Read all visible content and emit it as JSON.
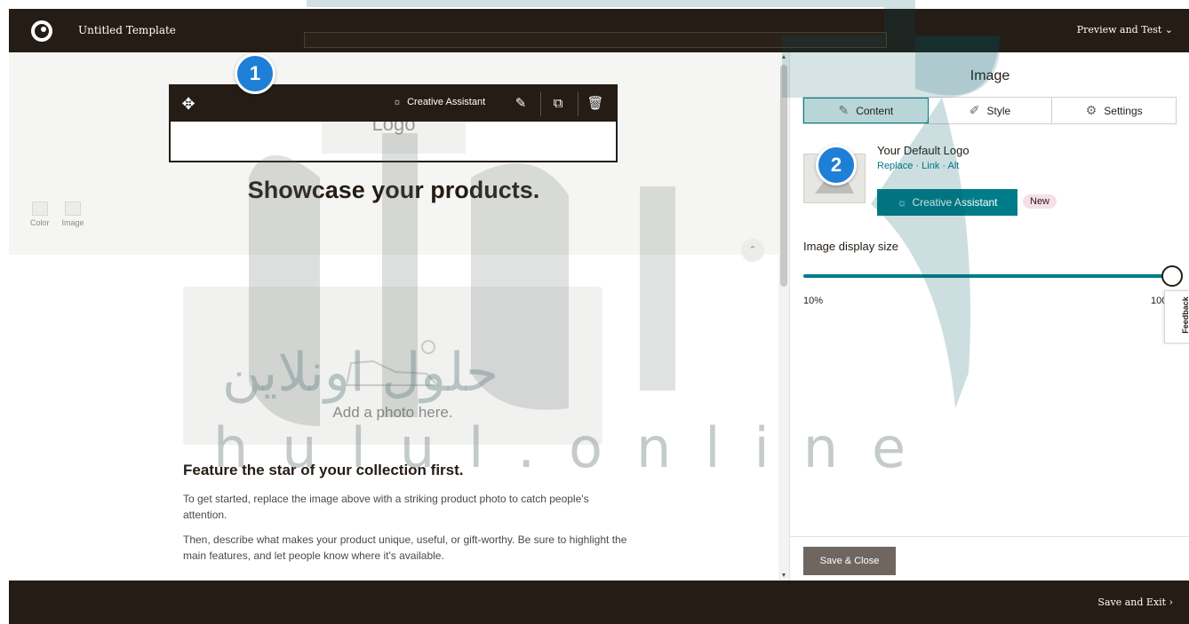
{
  "topbar": {
    "title": "Untitled Template",
    "preview_label": "Preview and Test"
  },
  "canvas": {
    "background_tools": {
      "color_label": "Color",
      "image_label": "Image"
    },
    "logo_placeholder": "Logo",
    "toolbar": {
      "creative_assistant_label": "Creative Assistant"
    },
    "headline": "Showcase your products.",
    "photo_label": "Add a photo here.",
    "feature_title": "Feature the star of your collection first.",
    "paragraph_1": "To get started, replace the image above with a striking product photo to catch people's attention.",
    "paragraph_2": "Then, describe what makes your product unique, useful, or gift-worthy. Be sure to highlight the main features, and let people know where it's available."
  },
  "panel": {
    "title": "Image",
    "tabs": [
      {
        "label": "Content",
        "icon": "edit-list-icon",
        "active": true
      },
      {
        "label": "Style",
        "icon": "paint-icon",
        "active": false
      },
      {
        "label": "Settings",
        "icon": "gear-icon",
        "active": false
      }
    ],
    "logo": {
      "name": "Your Default Logo",
      "replace_label": "Replace",
      "link_label": "Link",
      "alt_label": "Alt",
      "separator": "·"
    },
    "creative_assistant_label": "Creative Assistant",
    "new_badge": "New",
    "display_size_label": "Image display size",
    "slider": {
      "min_label": "10%",
      "max_label": "100%",
      "value_percent": 100
    },
    "feedback_label": "Feedback",
    "save_close_label": "Save & Close"
  },
  "bottombar": {
    "save_exit_label": "Save and Exit"
  },
  "callouts": {
    "one": "1",
    "two": "2"
  },
  "watermark": {
    "arabic": "حلول اونلاين",
    "latin": "hulul.online"
  },
  "colors": {
    "dark": "#241c15",
    "accent": "#007c89",
    "callout": "#1f7fd6",
    "badge": "#f6dfe7"
  }
}
